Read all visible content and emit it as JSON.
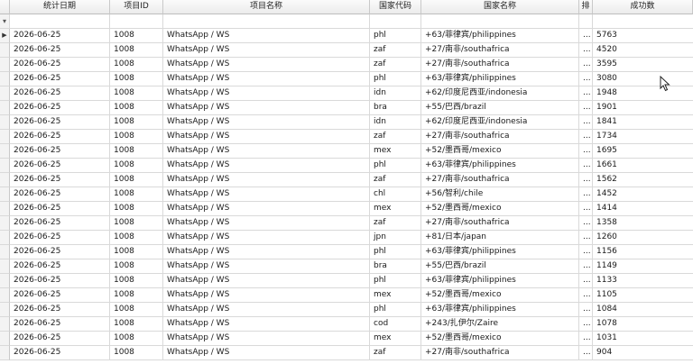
{
  "columns": [
    "统计日期",
    "项目ID",
    "项目名称",
    "国家代码",
    "国家名称",
    "排",
    "成功数"
  ],
  "icons": {
    "filter": "funnel-icon",
    "current_row": "row-indicator-arrow-icon",
    "cursor": "mouse-pointer-icon"
  },
  "rows": [
    [
      "2026-06-25",
      "1008",
      "WhatsApp / WS",
      "phl",
      "+63/菲律宾/philippines",
      "...",
      "5763"
    ],
    [
      "2026-06-25",
      "1008",
      "WhatsApp / WS",
      "zaf",
      "+27/南非/southafrica",
      "...",
      "4520"
    ],
    [
      "2026-06-25",
      "1008",
      "WhatsApp / WS",
      "zaf",
      "+27/南非/southafrica",
      "...",
      "3595"
    ],
    [
      "2026-06-25",
      "1008",
      "WhatsApp / WS",
      "phl",
      "+63/菲律宾/philippines",
      "...",
      "3080"
    ],
    [
      "2026-06-25",
      "1008",
      "WhatsApp / WS",
      "idn",
      "+62/印度尼西亚/indonesia",
      "...",
      "1948"
    ],
    [
      "2026-06-25",
      "1008",
      "WhatsApp / WS",
      "bra",
      "+55/巴西/brazil",
      "...",
      "1901"
    ],
    [
      "2026-06-25",
      "1008",
      "WhatsApp / WS",
      "idn",
      "+62/印度尼西亚/indonesia",
      "...",
      "1841"
    ],
    [
      "2026-06-25",
      "1008",
      "WhatsApp / WS",
      "zaf",
      "+27/南非/southafrica",
      "...",
      "1734"
    ],
    [
      "2026-06-25",
      "1008",
      "WhatsApp / WS",
      "mex",
      "+52/墨西哥/mexico",
      "...",
      "1695"
    ],
    [
      "2026-06-25",
      "1008",
      "WhatsApp / WS",
      "phl",
      "+63/菲律宾/philippines",
      "...",
      "1661"
    ],
    [
      "2026-06-25",
      "1008",
      "WhatsApp / WS",
      "zaf",
      "+27/南非/southafrica",
      "...",
      "1562"
    ],
    [
      "2026-06-25",
      "1008",
      "WhatsApp / WS",
      "chl",
      "+56/智利/chile",
      "...",
      "1452"
    ],
    [
      "2026-06-25",
      "1008",
      "WhatsApp / WS",
      "mex",
      "+52/墨西哥/mexico",
      "...",
      "1414"
    ],
    [
      "2026-06-25",
      "1008",
      "WhatsApp / WS",
      "zaf",
      "+27/南非/southafrica",
      "...",
      "1358"
    ],
    [
      "2026-06-25",
      "1008",
      "WhatsApp / WS",
      "jpn",
      "+81/日本/japan",
      "...",
      "1260"
    ],
    [
      "2026-06-25",
      "1008",
      "WhatsApp / WS",
      "phl",
      "+63/菲律宾/philippines",
      "...",
      "1156"
    ],
    [
      "2026-06-25",
      "1008",
      "WhatsApp / WS",
      "bra",
      "+55/巴西/brazil",
      "...",
      "1149"
    ],
    [
      "2026-06-25",
      "1008",
      "WhatsApp / WS",
      "phl",
      "+63/菲律宾/philippines",
      "...",
      "1133"
    ],
    [
      "2026-06-25",
      "1008",
      "WhatsApp / WS",
      "mex",
      "+52/墨西哥/mexico",
      "...",
      "1105"
    ],
    [
      "2026-06-25",
      "1008",
      "WhatsApp / WS",
      "phl",
      "+63/菲律宾/philippines",
      "...",
      "1084"
    ],
    [
      "2026-06-25",
      "1008",
      "WhatsApp / WS",
      "cod",
      "+243/扎伊尔/Zaire",
      "...",
      "1078"
    ],
    [
      "2026-06-25",
      "1008",
      "WhatsApp / WS",
      "mex",
      "+52/墨西哥/mexico",
      "...",
      "1031"
    ],
    [
      "2026-06-25",
      "1008",
      "WhatsApp / WS",
      "zaf",
      "+27/南非/southafrica",
      "...",
      "904"
    ]
  ]
}
